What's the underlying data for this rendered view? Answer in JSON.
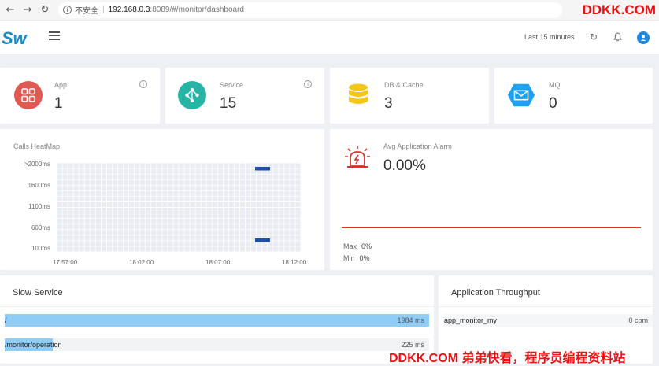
{
  "browser": {
    "security_label": "不安全",
    "url_host": "192.168.0.3",
    "url_path": ":8089/#/monitor/dashboard",
    "watermark": "DDKK.COM"
  },
  "header": {
    "logo": "Sw",
    "time_range": "Last 15 minutes"
  },
  "stats": [
    {
      "label": "App",
      "value": "1",
      "color": "#e05a52",
      "icon": "grid-icon"
    },
    {
      "label": "Service",
      "value": "15",
      "color": "#26b5a4",
      "icon": "share-icon"
    },
    {
      "label": "DB & Cache",
      "value": "3",
      "color": "#f5c518",
      "icon": "database-icon"
    },
    {
      "label": "MQ",
      "value": "0",
      "color": "#1da1f2",
      "icon": "mail-icon"
    }
  ],
  "heatmap": {
    "title": "Calls HeatMap",
    "y_labels": [
      ">2000ms",
      "1600ms",
      "1100ms",
      "600ms",
      "100ms"
    ],
    "x_labels": [
      "17:57:00",
      "18:02:00",
      "18:07:00",
      "18:12:00"
    ]
  },
  "alarm": {
    "title": "Avg Application Alarm",
    "value": "0.00%",
    "max_label": "Max",
    "max_value": "0%",
    "min_label": "Min",
    "min_value": "0%"
  },
  "slow_service": {
    "title": "Slow Service",
    "rows": [
      {
        "name": "/",
        "value": "1984 ms",
        "fraction": 1.0
      },
      {
        "name": "/monitor/operation",
        "value": "225 ms",
        "fraction": 0.113
      }
    ]
  },
  "throughput": {
    "title": "Application Throughput",
    "rows": [
      {
        "name": "app_monitor_my",
        "value": "0 cpm"
      }
    ]
  },
  "footer_watermark": "DDKK.COM 弟弟快看，程序员编程资料站"
}
